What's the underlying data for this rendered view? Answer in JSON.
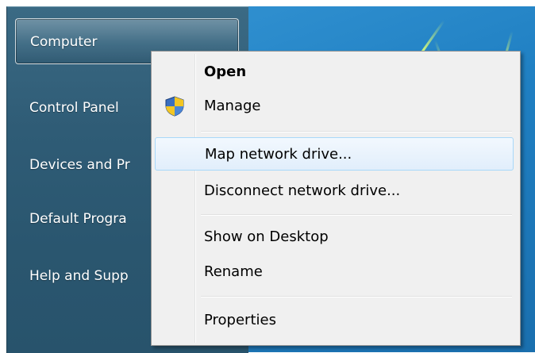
{
  "start_menu": {
    "items": [
      {
        "label": "Computer"
      },
      {
        "label": "Control Panel"
      },
      {
        "label": "Devices and Pr"
      },
      {
        "label": "Default Progra"
      },
      {
        "label": "Help and Supp"
      }
    ]
  },
  "context_menu": {
    "items": [
      {
        "label": "Open"
      },
      {
        "label": "Manage",
        "icon": "uac-shield-icon"
      },
      {
        "label": "Map network drive..."
      },
      {
        "label": "Disconnect network drive..."
      },
      {
        "label": "Show on Desktop"
      },
      {
        "label": "Rename"
      },
      {
        "label": "Properties"
      }
    ]
  },
  "colors": {
    "start_pane": "#2f5c76",
    "menu_bg": "#f0f0f0",
    "hover_border": "#a8d8f9"
  }
}
